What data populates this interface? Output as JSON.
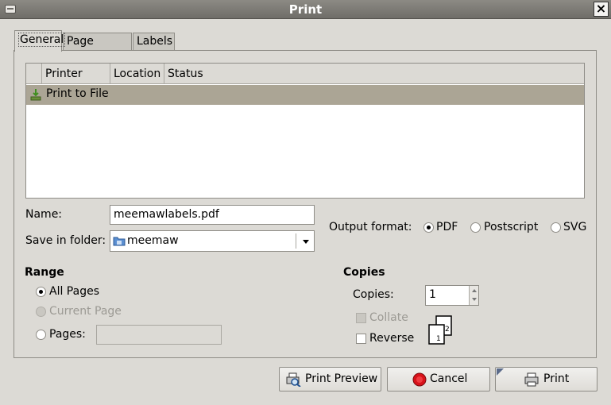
{
  "window": {
    "title": "Print"
  },
  "tabs": [
    "General",
    "Page Setup",
    "Labels"
  ],
  "printer_list": {
    "columns": [
      "Printer",
      "Location",
      "Status"
    ],
    "rows": [
      {
        "printer": "Print to File",
        "location": "",
        "status": ""
      }
    ]
  },
  "file": {
    "name_label": "Name:",
    "name_value": "meemawlabels.pdf",
    "folder_label": "Save in folder:",
    "folder_value": "meemaw"
  },
  "output_format": {
    "label": "Output format:",
    "options": [
      "PDF",
      "Postscript",
      "SVG"
    ],
    "selected": "PDF"
  },
  "range": {
    "heading": "Range",
    "all_pages": "All Pages",
    "current_page": "Current Page",
    "pages_label": "Pages:",
    "pages_value": "",
    "selected": "All Pages"
  },
  "copies": {
    "heading": "Copies",
    "copies_label": "Copies:",
    "copies_value": "1",
    "collate_label": "Collate",
    "reverse_label": "Reverse",
    "collate_pages": [
      "1",
      "2"
    ]
  },
  "buttons": {
    "print_preview": "Print Preview",
    "cancel": "Cancel",
    "print": "Print"
  },
  "colors": {
    "selected_row": "#aba595",
    "background": "#dcdad5",
    "titlebar": "#7e7c77"
  }
}
